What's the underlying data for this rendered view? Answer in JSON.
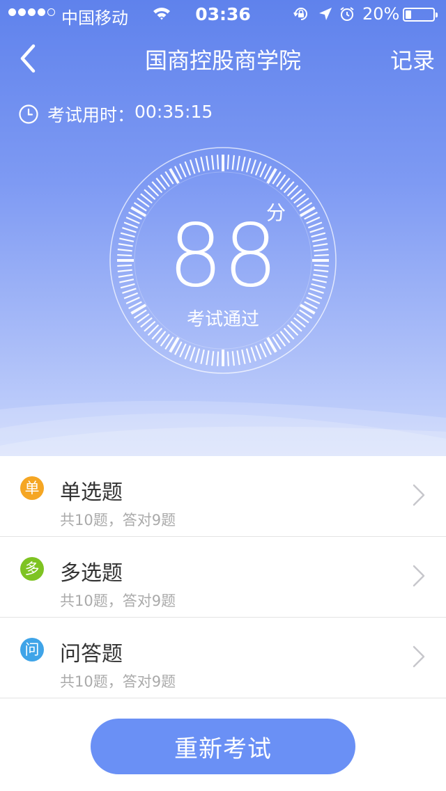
{
  "status_bar": {
    "carrier": "中国移动",
    "time": "03:36",
    "battery": "20%",
    "signal_icon": "signal-dots-icon",
    "wifi_icon": "wifi-icon",
    "lock_icon": "rotation-lock-icon",
    "location_icon": "location-arrow-icon",
    "alarm_icon": "alarm-icon",
    "battery_level": 0.2
  },
  "nav": {
    "back_icon": "chevron-left-icon",
    "title": "国商控股商学院",
    "records_label": "记录"
  },
  "exam_time": {
    "icon": "clock-icon",
    "label": "考试用时：",
    "value": "00:35:15"
  },
  "result": {
    "score": "88",
    "unit": "分",
    "status": "考试通过"
  },
  "sections": [
    {
      "badge": "单",
      "badge_color": "#f5a623",
      "title": "单选题",
      "summary": "共10题，答对9题"
    },
    {
      "badge": "多",
      "badge_color": "#7ec322",
      "title": "多选题",
      "summary": "共10题，答对9题"
    },
    {
      "badge": "问",
      "badge_color": "#3fa4e8",
      "title": "问答题",
      "summary": "共10题，答对9题"
    }
  ],
  "retry_button": {
    "label": "重新考试"
  },
  "colors": {
    "accent": "#6a90f5",
    "header_top": "#5f82ec",
    "header_bottom": "#c9d6fc"
  }
}
